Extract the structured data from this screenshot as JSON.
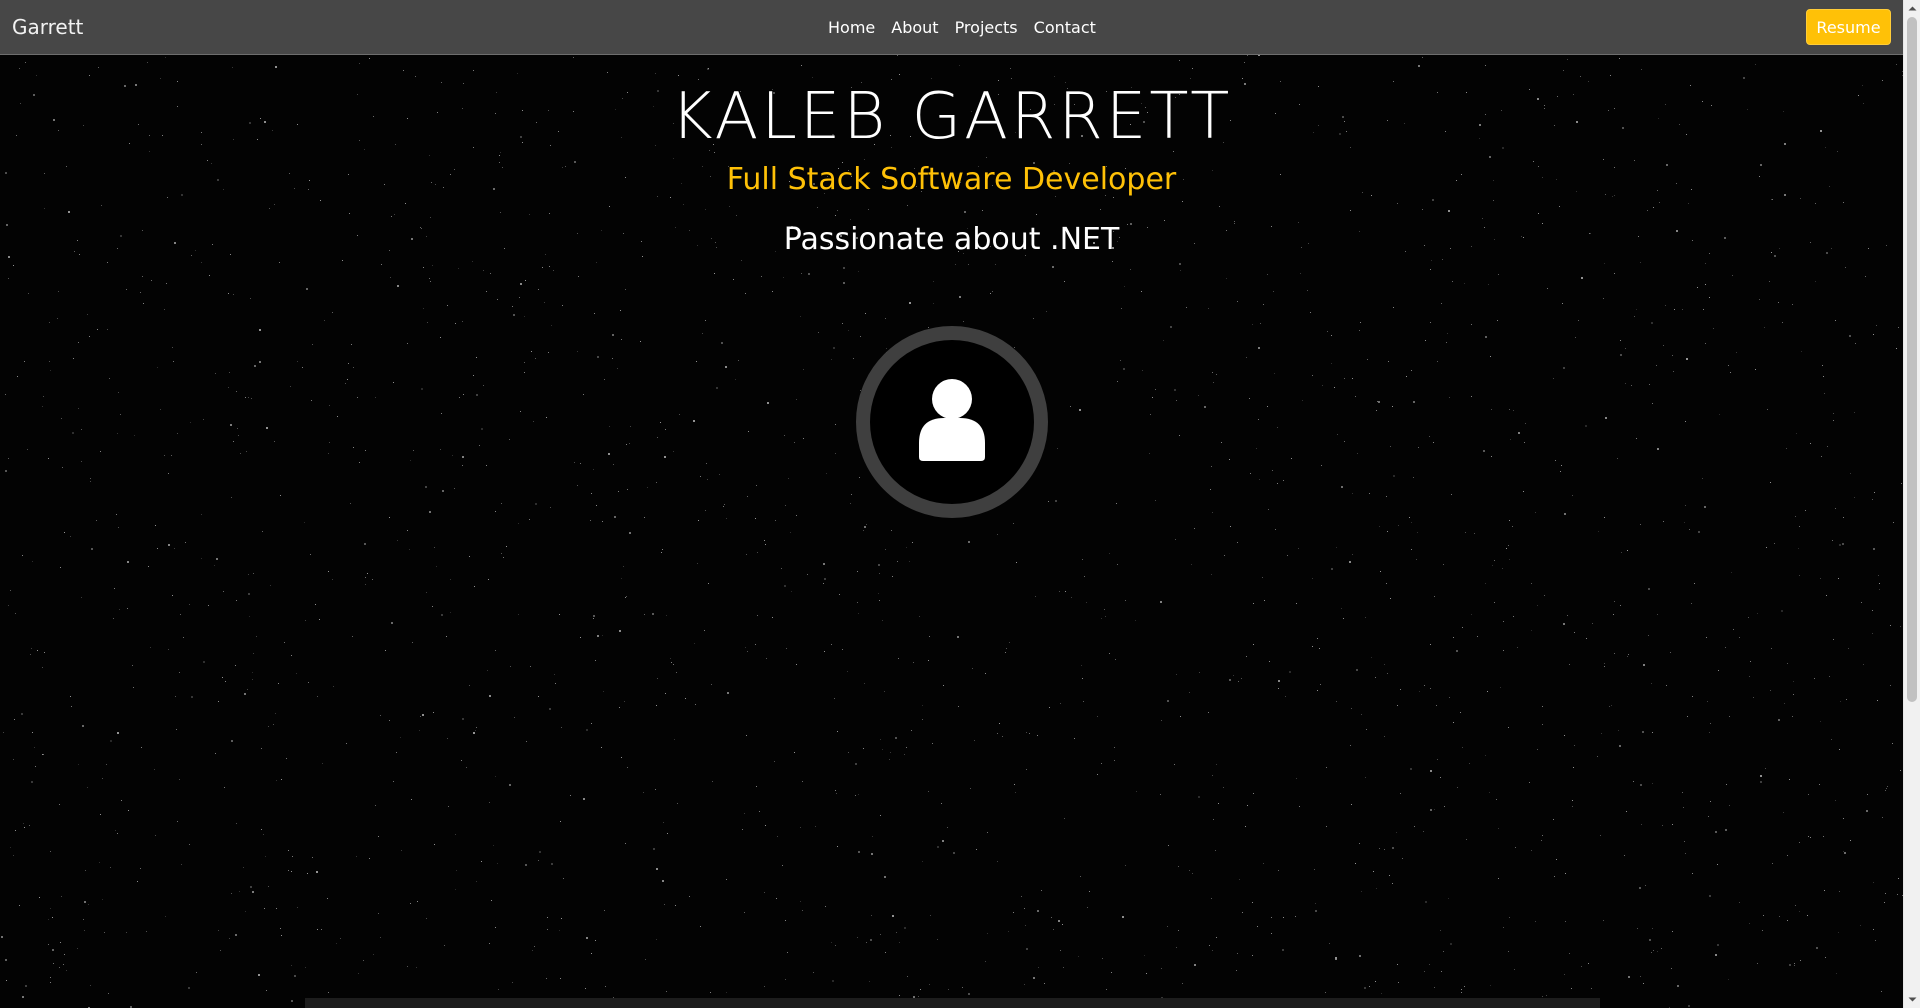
{
  "navbar": {
    "brand": "Garrett",
    "links": [
      {
        "label": "Home"
      },
      {
        "label": "About"
      },
      {
        "label": "Projects"
      },
      {
        "label": "Contact"
      }
    ],
    "resume_label": "Resume"
  },
  "hero": {
    "name": "KALEB GARRETT",
    "title": "Full Stack Software Developer",
    "tagline": "Passionate about .NET"
  },
  "avatar": {
    "icon": "user-icon"
  },
  "colors": {
    "navbar_bg": "#474747",
    "accent": "#ffc107",
    "background": "#000000",
    "ring": "#3f3f3f"
  }
}
